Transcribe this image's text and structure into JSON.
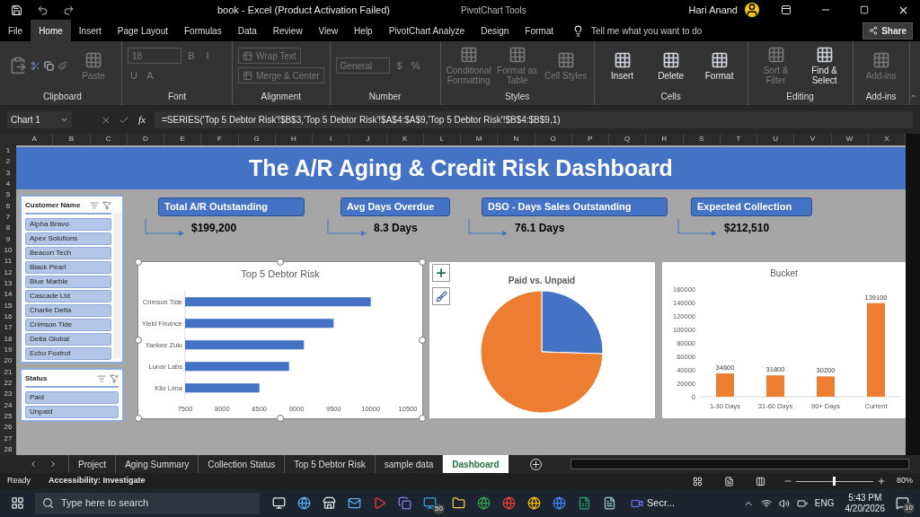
{
  "title_bar": {
    "title": "book  -  Excel (Product Activation Failed)",
    "context": "PivotChart Tools",
    "user": "Hari Anand"
  },
  "menu_tabs": [
    {
      "label": "File",
      "selected": false
    },
    {
      "label": "Home",
      "selected": true
    },
    {
      "label": "Insert",
      "selected": false
    },
    {
      "label": "Page Layout",
      "selected": false
    },
    {
      "label": "Formulas",
      "selected": false
    },
    {
      "label": "Data",
      "selected": false
    },
    {
      "label": "Review",
      "selected": false
    },
    {
      "label": "View",
      "selected": false
    },
    {
      "label": "Help",
      "selected": false
    },
    {
      "label": "PivotChart Analyze",
      "selected": false
    },
    {
      "label": "Design",
      "selected": false
    },
    {
      "label": "Format",
      "selected": false
    }
  ],
  "tell_me": {
    "placeholder": "Tell me what you want to do"
  },
  "share": "Share",
  "ribbon": [
    {
      "label": "Clipboard",
      "controls": [
        {
          "kind": "large",
          "label": "Paste",
          "disabled": true
        }
      ]
    },
    {
      "label": "Font",
      "controls": [
        {
          "kind": "field",
          "value": "18",
          "disabled": true
        },
        {
          "kind": "glyph",
          "label": "B",
          "disabled": true
        },
        {
          "kind": "glyph",
          "label": "I",
          "disabled": true
        },
        {
          "kind": "glyph",
          "label": "U",
          "disabled": true
        },
        {
          "kind": "glyph",
          "label": "A",
          "disabled": true
        }
      ]
    },
    {
      "label": "Alignment",
      "controls": [
        {
          "kind": "small",
          "label": "Wrap Text",
          "disabled": true
        },
        {
          "kind": "small",
          "label": "Merge & Center",
          "disabled": true
        }
      ]
    },
    {
      "label": "Number",
      "controls": [
        {
          "kind": "field",
          "value": "General",
          "disabled": true
        },
        {
          "kind": "glyph",
          "label": "$",
          "disabled": true
        },
        {
          "kind": "glyph",
          "label": "%",
          "disabled": true
        }
      ]
    },
    {
      "label": "Styles",
      "controls": [
        {
          "kind": "large",
          "label": "Conditional Formatting",
          "disabled": true
        },
        {
          "kind": "large",
          "label": "Format as Table",
          "disabled": true
        },
        {
          "kind": "large",
          "label": "Cell Styles",
          "disabled": true
        }
      ]
    },
    {
      "label": "Cells",
      "controls": [
        {
          "kind": "large",
          "label": "Insert",
          "disabled": false
        },
        {
          "kind": "large",
          "label": "Delete",
          "disabled": false
        },
        {
          "kind": "large",
          "label": "Format",
          "disabled": false
        }
      ]
    },
    {
      "label": "Editing",
      "controls": [
        {
          "kind": "large",
          "label": "Sort & Filter",
          "disabled": true
        },
        {
          "kind": "large",
          "label": "Find & Select",
          "disabled": false
        }
      ]
    },
    {
      "label": "Add-ins",
      "controls": [
        {
          "kind": "large",
          "label": "Add-ins",
          "disabled": true
        }
      ]
    }
  ],
  "formula_bar": {
    "name_box": "Chart 1",
    "function_label": "fx",
    "formula": "=SERIES('Top 5 Debtor Risk'!$B$3,'Top 5 Debtor Risk'!$A$4:$A$9,'Top 5 Debtor Risk'!$B$4:$B$9,1)"
  },
  "columns": [
    "A",
    "B",
    "C",
    "D",
    "E",
    "F",
    "G",
    "H",
    "I",
    "J",
    "K",
    "L",
    "M",
    "N",
    "O",
    "P",
    "Q",
    "R",
    "S",
    "T",
    "U",
    "V",
    "W",
    "X"
  ],
  "rows": [
    "1",
    "2",
    "3",
    "4",
    "5",
    "6",
    "7",
    "8",
    "9",
    "10",
    "11",
    "12",
    "13",
    "14",
    "15",
    "16",
    "17",
    "18",
    "19",
    "20",
    "21",
    "22",
    "23",
    "24",
    "25",
    "26",
    "27",
    "28"
  ],
  "dashboard": {
    "title": "The A/R Aging & Credit Risk Dashboard",
    "slicers": [
      {
        "title": "Customer Name",
        "items": [
          {
            "label": "Alpha Bravo",
            "selected": true
          },
          {
            "label": "Apex Solutions",
            "selected": true
          },
          {
            "label": "Beacon Tech",
            "selected": true
          },
          {
            "label": "Black Pearl",
            "selected": true
          },
          {
            "label": "Blue Marble",
            "selected": true
          },
          {
            "label": "Cascade Ltd",
            "selected": true
          },
          {
            "label": "Charlie Delta",
            "selected": true
          },
          {
            "label": "Crimson Tide",
            "selected": true
          },
          {
            "label": "Delta Global",
            "selected": true
          },
          {
            "label": "Echo Foxtrot",
            "selected": true
          }
        ]
      },
      {
        "title": "Status",
        "items": [
          {
            "label": "Paid",
            "selected": true
          },
          {
            "label": "Unpaid",
            "selected": true
          }
        ]
      }
    ],
    "kpis": [
      {
        "label": "Total A/R Outstanding",
        "value": "$199,200"
      },
      {
        "label": "Avg Days Overdue",
        "value": "8.3 Days"
      },
      {
        "label": "DSO - Days Sales Outstanding",
        "value": "76.1 Days"
      },
      {
        "label": "Expected Collection",
        "value": "$212,510"
      }
    ],
    "bar_chart": {
      "selected": true,
      "chart_data": {
        "type": "bar",
        "orientation": "horizontal",
        "title": "Top 5 Debtor Risk",
        "categories": [
          "Crimson Tide",
          "Yield Finance",
          "Yankee Zulu",
          "Lunar Labs",
          "Kilo Lima"
        ],
        "values": [
          10000,
          9500,
          9100,
          8900,
          8500
        ],
        "xlim": [
          7500,
          10500
        ],
        "xticks": [
          7500,
          8000,
          8500,
          9000,
          9500,
          10000,
          10500
        ]
      }
    },
    "pie_chart": {
      "title": "Paid vs. Unpaid"
    },
    "column_chart": {
      "chart_data": {
        "type": "bar",
        "title": "Bucket",
        "categories": [
          "1-30 Days",
          "31-60 Days",
          "90+ Days",
          "Current"
        ],
        "values": [
          34600,
          31800,
          30200,
          139100
        ],
        "ylim": [
          0,
          160000
        ],
        "yticks": [
          0,
          20000,
          40000,
          60000,
          80000,
          100000,
          120000,
          140000,
          160000
        ],
        "data_labels": true
      }
    }
  },
  "sheet_tabs": [
    {
      "label": "Project",
      "selected": false
    },
    {
      "label": "Aging Summary",
      "selected": false
    },
    {
      "label": "Collection Status",
      "selected": false
    },
    {
      "label": "Top 5 Debtor Risk",
      "selected": false
    },
    {
      "label": "sample data",
      "selected": false
    },
    {
      "label": "Dashboard",
      "selected": true
    }
  ],
  "status_bar": {
    "status": "Ready",
    "accessibility": "Accessibility: Investigate",
    "zoom": {
      "level": 0.5,
      "reading": "80%"
    }
  },
  "taskbar": {
    "search_placeholder": "Type here to search",
    "badge": "50",
    "app_label": "Secr...",
    "language": "ENG",
    "time": "5:43 PM",
    "date": "4/20/2026",
    "notifications": "10"
  }
}
